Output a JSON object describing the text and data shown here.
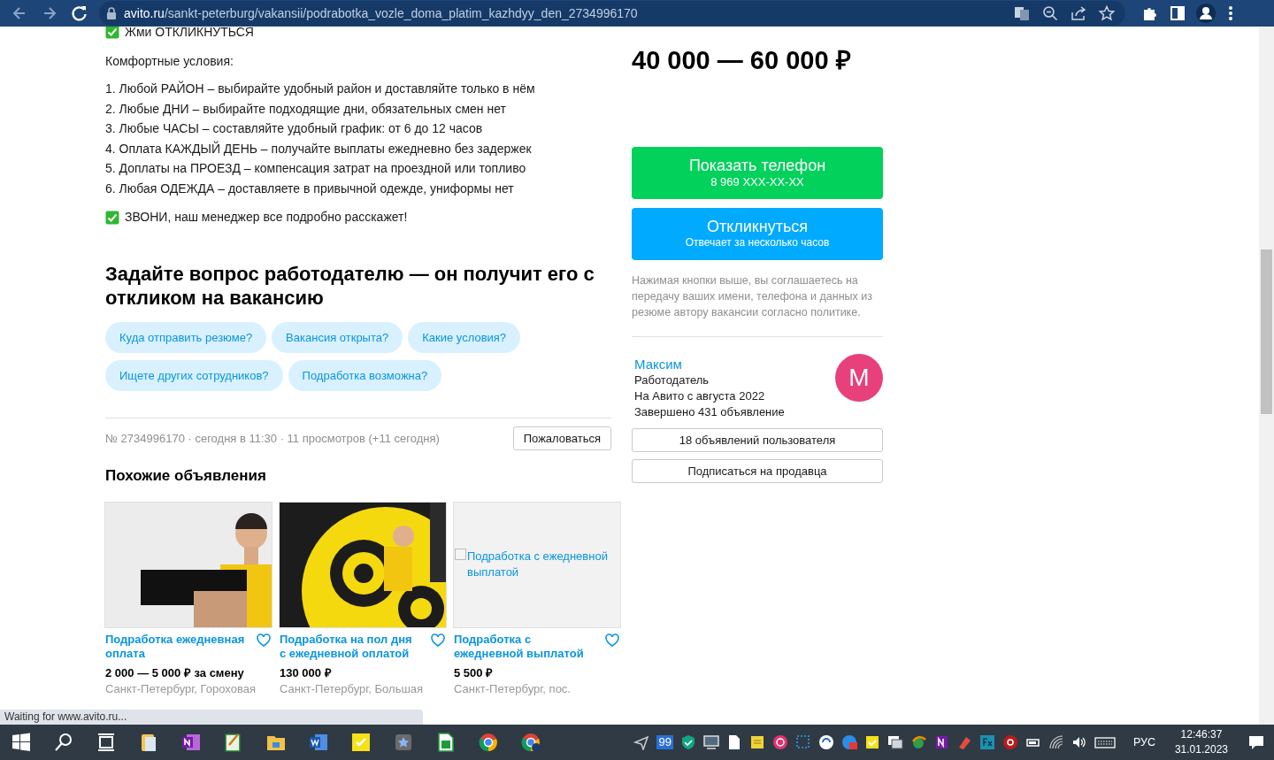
{
  "browser": {
    "url_host": "avito.ru",
    "url_path": "/sankt-peterburg/vakansii/podrabotka_vozle_doma_platim_kazhdyy_den_2734996170"
  },
  "description": {
    "top_line": "Жми ОТКЛИКНУТЬСЯ",
    "conditions_title": "Комфортные условия:",
    "conditions": [
      "1. Любой РАЙОН – выбирайте удобный район и доставляйте только в нём",
      "2. Любые ДНИ – выбирайте подходящие дни, обязательных смен нет",
      "3. Любые ЧАСЫ – составляйте удобный график: от 6 до 12 часов",
      "4. Оплата КАЖДЫЙ ДЕНЬ – получайте выплаты ежедневно без задержек",
      "5. Доплаты на ПРОЕЗД – компенсация затрат на проездной или топливо",
      "6. Любая ОДЕЖДА – доставляете в привычной одежде, униформы нет"
    ],
    "call_line": "ЗВОНИ, наш менеджер все подробно расскажет!"
  },
  "questions": {
    "title": "Задайте вопрос работодателю — он получит его с откликом на вакансию",
    "chips": [
      "Куда отправить резюме?",
      "Вакансия открыта?",
      "Какие условия?",
      "Ищете других сотрудников?",
      "Подработка возможна?"
    ]
  },
  "meta": {
    "info": "№ 2734996170 · сегодня в 11:30 · 11 просмотров (+11 сегодня)",
    "report_button": "Пожаловаться"
  },
  "similar": {
    "title": "Похожие объявления",
    "items": [
      {
        "kind": "picture",
        "title": "Подработка ежедневная оплата",
        "price": "2 000 — 5 000 ₽ за смену",
        "location": "Санкт-Петербург, Гороховая"
      },
      {
        "kind": "picture",
        "title": "Подработка на пол дня с ежедневной оплатой",
        "price": "130 000 ₽",
        "location": "Санкт-Петербург, Большая"
      },
      {
        "kind": "broken",
        "alt": "Подработка с ежедневной выплатой",
        "title": "Подработка с ежедневной выплатой",
        "price": "5 500 ₽",
        "location": "Санкт-Петербург, пос."
      }
    ]
  },
  "sidebar": {
    "salary": "40 000 — 60 000 ₽",
    "phone_button": {
      "label": "Показать телефон",
      "sub": "8 969 XXX-XX-XX"
    },
    "respond_button": {
      "label": "Откликнуться",
      "sub": "Отвечает за несколько часов"
    },
    "consent": "Нажимая кнопки выше, вы соглашаетесь на передачу ваших имени, телефона и данных из резюме автору вакансии согласно политике.",
    "seller": {
      "name": "Максим",
      "role": "Работодатель",
      "since": "На Авито с августа 2022",
      "completed": "Завершено 431 объявление",
      "avatar_letter": "M"
    },
    "buttons": [
      "18 объявлений пользователя",
      "Подписаться на продавца"
    ]
  },
  "status_bubble": "Waiting for www.avito.ru...",
  "taskbar": {
    "tray_badge": "99",
    "language": "РУС",
    "time": "12:46:37",
    "date": "31.01.2023"
  }
}
